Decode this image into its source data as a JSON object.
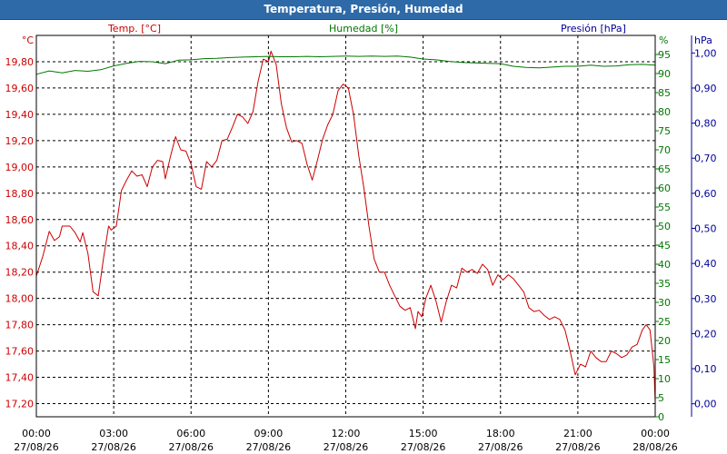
{
  "window": {
    "title": "Temperatura, Presión, Humedad"
  },
  "chart_data": {
    "type": "line",
    "title": "Temperatura, Presión, Humedad",
    "grid": true,
    "legend": [
      "Temp. [°C]",
      "Humedad [%]",
      "Presión [hPa]"
    ],
    "axes": {
      "temp": {
        "unit": "°C",
        "ylim": [
          17.1,
          20.0
        ],
        "ticks": [
          17.2,
          17.4,
          17.6,
          17.8,
          18.0,
          18.2,
          18.4,
          18.6,
          18.8,
          19.0,
          19.2,
          19.4,
          19.6,
          19.8
        ],
        "color": "#cc0000"
      },
      "hum": {
        "unit": "%",
        "ylim": [
          0,
          100
        ],
        "ticks": [
          0,
          5,
          10,
          15,
          20,
          25,
          30,
          35,
          40,
          45,
          50,
          55,
          60,
          65,
          70,
          75,
          80,
          85,
          90,
          95
        ],
        "color": "#007700"
      },
      "pres": {
        "unit": "hPa",
        "ylim": [
          -0.037,
          1.05
        ],
        "ticks": [
          0.0,
          0.1,
          0.2,
          0.3,
          0.4,
          0.5,
          0.6,
          0.7,
          0.8,
          0.9,
          1.0
        ],
        "tick_labels": [
          "0,00",
          "0,10",
          "0,20",
          "0,30",
          "0,40",
          "0,50",
          "0,60",
          "0,70",
          "0,80",
          "0,90",
          "1,00"
        ],
        "color": "#000099"
      }
    },
    "x_labels": [
      {
        "h": 0,
        "time": "00:00",
        "date": "27/08/26"
      },
      {
        "h": 3,
        "time": "03:00",
        "date": "27/08/26"
      },
      {
        "h": 6,
        "time": "06:00",
        "date": "27/08/26"
      },
      {
        "h": 9,
        "time": "09:00",
        "date": "27/08/26"
      },
      {
        "h": 12,
        "time": "12:00",
        "date": "27/08/26"
      },
      {
        "h": 15,
        "time": "15:00",
        "date": "27/08/26"
      },
      {
        "h": 18,
        "time": "18:00",
        "date": "27/08/26"
      },
      {
        "h": 21,
        "time": "21:00",
        "date": "27/08/26"
      },
      {
        "h": 24,
        "time": "00:00",
        "date": "28/08/26"
      }
    ],
    "series": [
      {
        "name": "Temp. [°C]",
        "axis": "temp",
        "color": "#cc0000",
        "points": [
          [
            0.0,
            18.17
          ],
          [
            0.25,
            18.32
          ],
          [
            0.5,
            18.51
          ],
          [
            0.7,
            18.44
          ],
          [
            0.9,
            18.47
          ],
          [
            1.0,
            18.55
          ],
          [
            1.3,
            18.55
          ],
          [
            1.5,
            18.5
          ],
          [
            1.7,
            18.43
          ],
          [
            1.8,
            18.5
          ],
          [
            2.0,
            18.34
          ],
          [
            2.2,
            18.05
          ],
          [
            2.4,
            18.02
          ],
          [
            2.6,
            18.3
          ],
          [
            2.8,
            18.55
          ],
          [
            2.9,
            18.52
          ],
          [
            3.1,
            18.55
          ],
          [
            3.3,
            18.82
          ],
          [
            3.5,
            18.9
          ],
          [
            3.7,
            18.97
          ],
          [
            3.9,
            18.93
          ],
          [
            4.1,
            18.94
          ],
          [
            4.3,
            18.85
          ],
          [
            4.5,
            19.0
          ],
          [
            4.7,
            19.05
          ],
          [
            4.9,
            19.04
          ],
          [
            5.0,
            18.91
          ],
          [
            5.2,
            19.08
          ],
          [
            5.4,
            19.23
          ],
          [
            5.6,
            19.13
          ],
          [
            5.8,
            19.12
          ],
          [
            6.0,
            19.02
          ],
          [
            6.2,
            18.85
          ],
          [
            6.4,
            18.83
          ],
          [
            6.6,
            19.04
          ],
          [
            6.8,
            19.0
          ],
          [
            7.0,
            19.05
          ],
          [
            7.2,
            19.2
          ],
          [
            7.4,
            19.21
          ],
          [
            7.6,
            19.3
          ],
          [
            7.8,
            19.4
          ],
          [
            8.0,
            19.38
          ],
          [
            8.2,
            19.33
          ],
          [
            8.4,
            19.42
          ],
          [
            8.6,
            19.65
          ],
          [
            8.8,
            19.82
          ],
          [
            9.0,
            19.8
          ],
          [
            9.1,
            19.88
          ],
          [
            9.3,
            19.78
          ],
          [
            9.5,
            19.48
          ],
          [
            9.7,
            19.3
          ],
          [
            9.9,
            19.19
          ],
          [
            10.1,
            19.2
          ],
          [
            10.3,
            19.18
          ],
          [
            10.5,
            19.02
          ],
          [
            10.7,
            18.9
          ],
          [
            10.9,
            19.05
          ],
          [
            11.1,
            19.21
          ],
          [
            11.3,
            19.32
          ],
          [
            11.5,
            19.4
          ],
          [
            11.7,
            19.58
          ],
          [
            11.9,
            19.63
          ],
          [
            12.1,
            19.6
          ],
          [
            12.3,
            19.4
          ],
          [
            12.5,
            19.09
          ],
          [
            12.7,
            18.84
          ],
          [
            12.9,
            18.55
          ],
          [
            13.1,
            18.3
          ],
          [
            13.3,
            18.2
          ],
          [
            13.5,
            18.2
          ],
          [
            13.7,
            18.1
          ],
          [
            13.9,
            18.02
          ],
          [
            14.1,
            17.94
          ],
          [
            14.3,
            17.91
          ],
          [
            14.5,
            17.93
          ],
          [
            14.7,
            17.77
          ],
          [
            14.8,
            17.9
          ],
          [
            14.95,
            17.86
          ],
          [
            15.1,
            18.0
          ],
          [
            15.3,
            18.1
          ],
          [
            15.5,
            17.98
          ],
          [
            15.7,
            17.82
          ],
          [
            15.9,
            17.98
          ],
          [
            16.1,
            18.1
          ],
          [
            16.3,
            18.08
          ],
          [
            16.5,
            18.23
          ],
          [
            16.7,
            18.2
          ],
          [
            16.9,
            18.22
          ],
          [
            17.1,
            18.19
          ],
          [
            17.3,
            18.26
          ],
          [
            17.5,
            18.22
          ],
          [
            17.7,
            18.1
          ],
          [
            17.9,
            18.18
          ],
          [
            18.1,
            18.14
          ],
          [
            18.3,
            18.18
          ],
          [
            18.5,
            18.15
          ],
          [
            18.7,
            18.1
          ],
          [
            18.9,
            18.05
          ],
          [
            19.1,
            17.93
          ],
          [
            19.3,
            17.9
          ],
          [
            19.5,
            17.91
          ],
          [
            19.7,
            17.87
          ],
          [
            19.9,
            17.84
          ],
          [
            20.1,
            17.86
          ],
          [
            20.3,
            17.84
          ],
          [
            20.5,
            17.76
          ],
          [
            20.7,
            17.6
          ],
          [
            20.9,
            17.42
          ],
          [
            21.1,
            17.5
          ],
          [
            21.3,
            17.48
          ],
          [
            21.5,
            17.6
          ],
          [
            21.7,
            17.55
          ],
          [
            21.9,
            17.52
          ],
          [
            22.1,
            17.52
          ],
          [
            22.3,
            17.6
          ],
          [
            22.5,
            17.58
          ],
          [
            22.7,
            17.55
          ],
          [
            22.9,
            17.57
          ],
          [
            23.1,
            17.63
          ],
          [
            23.3,
            17.65
          ],
          [
            23.5,
            17.76
          ],
          [
            23.65,
            17.8
          ],
          [
            23.8,
            17.76
          ],
          [
            23.95,
            17.48
          ],
          [
            24.0,
            17.21
          ]
        ]
      },
      {
        "name": "Humedad [%]",
        "axis": "hum",
        "color": "#007700",
        "points": [
          [
            0.0,
            89.8
          ],
          [
            0.5,
            90.7
          ],
          [
            1.0,
            90.2
          ],
          [
            1.5,
            90.8
          ],
          [
            2.0,
            90.6
          ],
          [
            2.5,
            91.0
          ],
          [
            3.0,
            92.0
          ],
          [
            3.5,
            92.7
          ],
          [
            4.0,
            93.2
          ],
          [
            4.5,
            93.1
          ],
          [
            5.0,
            92.6
          ],
          [
            5.5,
            93.5
          ],
          [
            6.0,
            93.6
          ],
          [
            6.5,
            93.9
          ],
          [
            7.0,
            94.0
          ],
          [
            7.5,
            94.2
          ],
          [
            8.0,
            94.3
          ],
          [
            8.5,
            94.4
          ],
          [
            9.0,
            94.5
          ],
          [
            9.5,
            94.4
          ],
          [
            10.0,
            94.4
          ],
          [
            10.5,
            94.5
          ],
          [
            11.0,
            94.4
          ],
          [
            11.5,
            94.5
          ],
          [
            12.0,
            94.6
          ],
          [
            12.5,
            94.5
          ],
          [
            13.0,
            94.6
          ],
          [
            13.5,
            94.5
          ],
          [
            14.0,
            94.6
          ],
          [
            14.5,
            94.3
          ],
          [
            15.0,
            93.8
          ],
          [
            15.5,
            93.6
          ],
          [
            16.0,
            93.2
          ],
          [
            16.5,
            92.9
          ],
          [
            17.0,
            92.8
          ],
          [
            17.5,
            92.7
          ],
          [
            18.0,
            92.6
          ],
          [
            18.5,
            91.9
          ],
          [
            19.0,
            91.6
          ],
          [
            19.5,
            91.5
          ],
          [
            20.0,
            91.7
          ],
          [
            20.5,
            91.9
          ],
          [
            21.0,
            91.9
          ],
          [
            21.5,
            92.2
          ],
          [
            22.0,
            91.9
          ],
          [
            22.5,
            92.0
          ],
          [
            23.0,
            92.3
          ],
          [
            23.5,
            92.4
          ],
          [
            24.0,
            92.2
          ]
        ]
      }
    ]
  }
}
